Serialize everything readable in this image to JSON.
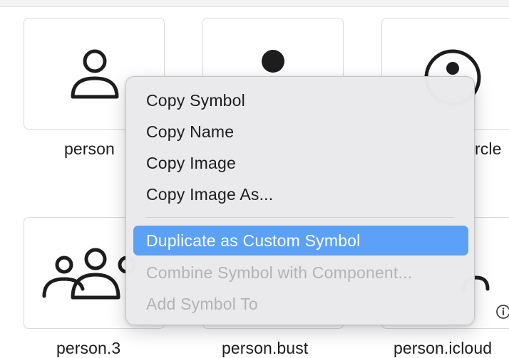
{
  "grid": {
    "cells": [
      {
        "label": "person",
        "icon": "person-icon"
      },
      {
        "label": "",
        "icon": "person-fill-icon"
      },
      {
        "label": "rcle",
        "icon": "person-crop-circle-icon"
      },
      {
        "label": "person.3",
        "icon": "person-3-icon"
      },
      {
        "label": "person.bust",
        "icon": "person-bust-icon"
      },
      {
        "label": "person.icloud",
        "icon": "person-icloud-icon"
      }
    ]
  },
  "context_menu": {
    "items": [
      {
        "label": "Copy Symbol",
        "state": "normal"
      },
      {
        "label": "Copy Name",
        "state": "normal"
      },
      {
        "label": "Copy Image",
        "state": "normal"
      },
      {
        "label": "Copy Image As...",
        "state": "normal"
      },
      {
        "label": "Duplicate as Custom Symbol",
        "state": "highlighted"
      },
      {
        "label": "Combine Symbol with Component...",
        "state": "disabled"
      },
      {
        "label": "Add Symbol To",
        "state": "disabled"
      }
    ]
  },
  "colors": {
    "highlight": "#5ba1f7",
    "menu_background": "#eaeaec",
    "disabled_text": "#b3b3b5"
  },
  "info_icon": "info-circle-icon"
}
